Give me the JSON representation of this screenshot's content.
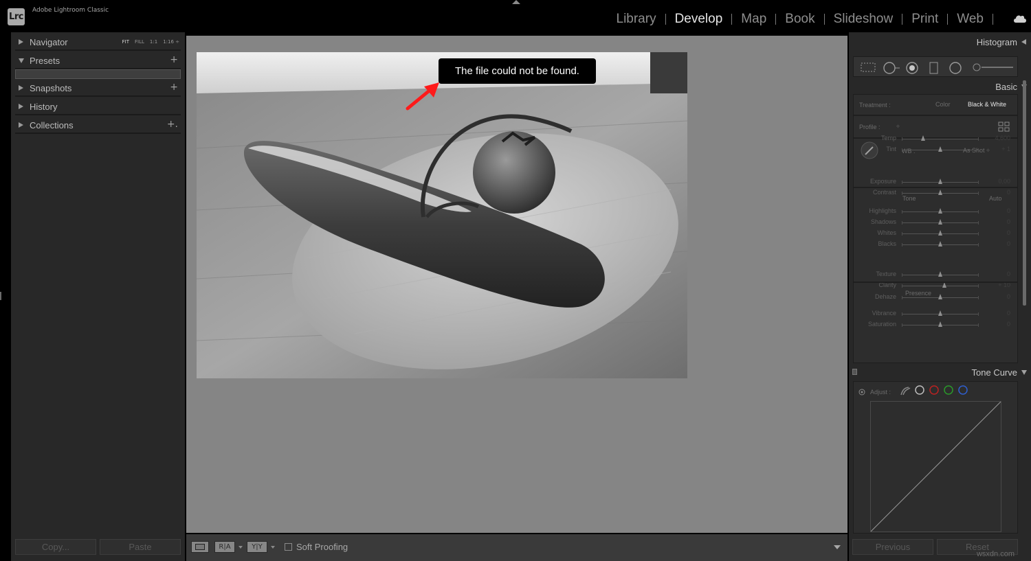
{
  "app": {
    "badge": "Lrc",
    "title": "Adobe Lightroom Classic"
  },
  "modules": [
    {
      "label": "Library",
      "active": false
    },
    {
      "label": "Develop",
      "active": true
    },
    {
      "label": "Map",
      "active": false
    },
    {
      "label": "Book",
      "active": false
    },
    {
      "label": "Slideshow",
      "active": false
    },
    {
      "label": "Print",
      "active": false
    },
    {
      "label": "Web",
      "active": false
    }
  ],
  "left_panel": {
    "navigator": {
      "label": "Navigator",
      "zoom": [
        "FIT",
        "FILL",
        "1:1",
        "1:16 ÷"
      ]
    },
    "presets": {
      "label": "Presets",
      "plus": "+"
    },
    "snapshots": {
      "label": "Snapshots",
      "plus": "+"
    },
    "history": {
      "label": "History"
    },
    "collections": {
      "label": "Collections",
      "plus": "+."
    },
    "copy_label": "Copy...",
    "paste_label": "Paste"
  },
  "center": {
    "tooltip": "The file could not be found.",
    "arrow_color": "#ff1a1a"
  },
  "toolbar": {
    "soft_proofing_label": "Soft Proofing",
    "box_a": "R|A",
    "box_b": "Y|Y"
  },
  "right_panel": {
    "histogram": {
      "title": "Histogram"
    },
    "basic": {
      "title": "Basic",
      "treatment_label": "Treatment :",
      "treatment_color": "Color",
      "treatment_bw": "Black & White",
      "profile_label": "Profile :",
      "profile_arrows": "÷",
      "wb_label": "WB :",
      "wb_value": "As Shot ÷",
      "tone_label": "Tone",
      "auto_label": "Auto",
      "presence_label": "Presence"
    },
    "sliders": [
      {
        "label": "Temp",
        "value": "4,600",
        "pos": 0.28
      },
      {
        "label": "Tint",
        "value": "+ 1",
        "pos": 0.5
      },
      {
        "label": "Exposure",
        "value": "0,00",
        "pos": 0.5
      },
      {
        "label": "Contrast",
        "value": "0",
        "pos": 0.5
      },
      {
        "label": "Highlights",
        "value": "0",
        "pos": 0.5
      },
      {
        "label": "Shadows",
        "value": "0",
        "pos": 0.5
      },
      {
        "label": "Whites",
        "value": "0",
        "pos": 0.5
      },
      {
        "label": "Blacks",
        "value": "0",
        "pos": 0.5
      },
      {
        "label": "Texture",
        "value": "0",
        "pos": 0.5
      },
      {
        "label": "Clarity",
        "value": "+ 10",
        "pos": 0.55
      },
      {
        "label": "Dehaze",
        "value": "0",
        "pos": 0.5
      },
      {
        "label": "Vibrance",
        "value": "0",
        "pos": 0.5
      },
      {
        "label": "Saturation",
        "value": "0",
        "pos": 0.5
      }
    ],
    "tone_curve": {
      "title": "Tone Curve",
      "adjust_label": "Adjust :"
    },
    "previous_label": "Previous",
    "reset_label": "Reset",
    "watermark": "wsxdn.com"
  }
}
